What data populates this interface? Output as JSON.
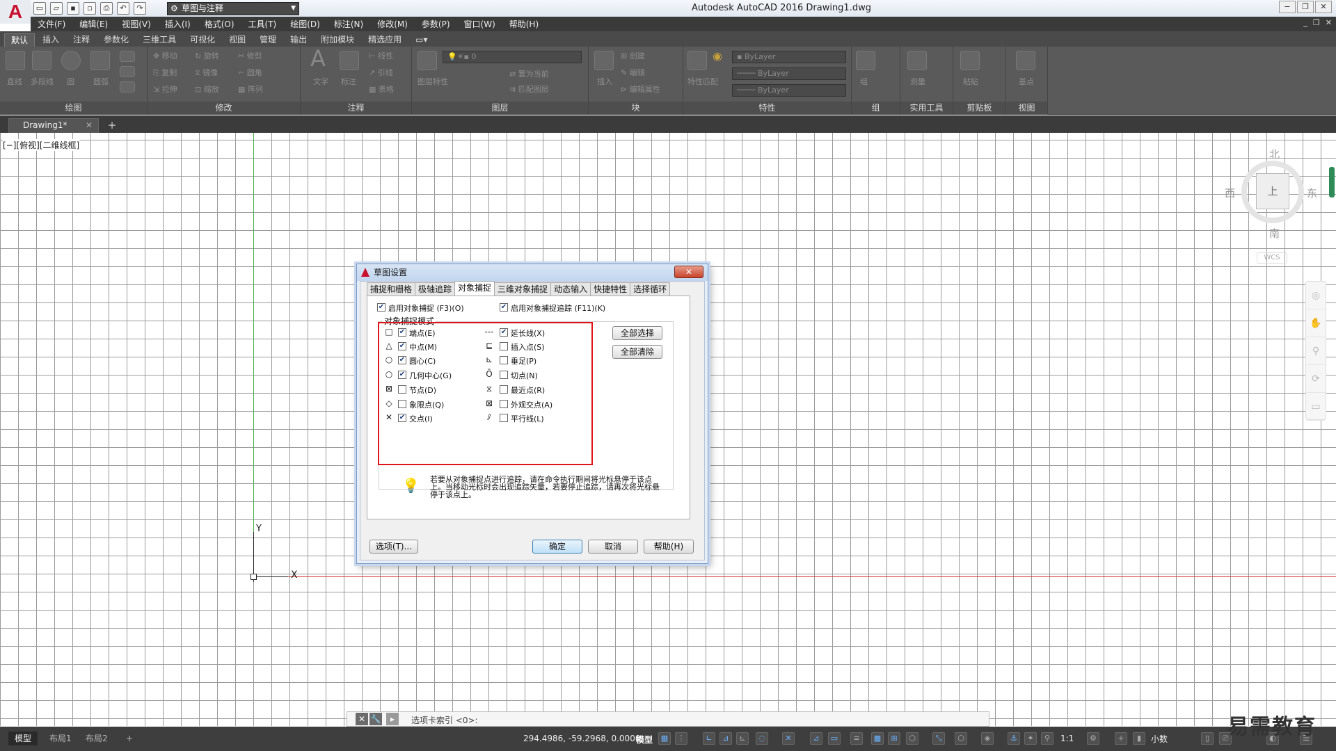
{
  "app": {
    "title": "Autodesk AutoCAD 2016    Drawing1.dwg",
    "workspace": "草图与注释",
    "window_buttons": [
      "−",
      "❐",
      "✕"
    ],
    "menu_window_buttons": [
      "_",
      "❐",
      "✕"
    ]
  },
  "menu": [
    "文件(F)",
    "编辑(E)",
    "视图(V)",
    "插入(I)",
    "格式(O)",
    "工具(T)",
    "绘图(D)",
    "标注(N)",
    "修改(M)",
    "参数(P)",
    "窗口(W)",
    "帮助(H)"
  ],
  "ribbon_tabs": [
    "默认",
    "插入",
    "注释",
    "参数化",
    "三维工具",
    "可视化",
    "视图",
    "管理",
    "输出",
    "附加模块",
    "精选应用"
  ],
  "ribbon": {
    "draw": {
      "title": "绘图",
      "tools": [
        "直线",
        "多段线",
        "圆",
        "圆弧"
      ]
    },
    "modify": {
      "title": "修改",
      "rows": [
        [
          "移动",
          "旋转",
          "修剪"
        ],
        [
          "复制",
          "镜像",
          "圆角"
        ],
        [
          "拉伸",
          "缩放",
          "阵列"
        ]
      ]
    },
    "annotation": {
      "title": "注释",
      "tools": [
        "文字",
        "标注"
      ],
      "small": [
        "线性",
        "引线",
        "表格"
      ]
    },
    "layers": {
      "title": "图层",
      "tools": [
        "图层特性"
      ],
      "layer_value": "0",
      "small": [
        "置为当前",
        "匹配图层"
      ]
    },
    "block": {
      "title": "块",
      "tools": [
        "插入"
      ],
      "small": [
        "创建",
        "编辑",
        "编辑属性"
      ]
    },
    "properties": {
      "title": "特性",
      "tools": [
        "特性匹配"
      ],
      "combos": [
        "ByLayer",
        "ByLayer",
        "ByLayer"
      ]
    },
    "groups": {
      "title": "组",
      "tools": [
        "组"
      ]
    },
    "utilities": {
      "title": "实用工具",
      "tools": [
        "测量"
      ]
    },
    "clipboard": {
      "title": "剪贴板",
      "tools": [
        "粘贴"
      ]
    },
    "view": {
      "title": "视图",
      "tools": [
        "基点"
      ]
    }
  },
  "document_tab": "Drawing1*",
  "viewport_label": "[−][俯视][二维线框]",
  "ucs": {
    "y": "Y",
    "x": "X"
  },
  "viewcube": {
    "north": "北",
    "south": "南",
    "west": "西",
    "east": "东",
    "top": "上",
    "wcs": "WCS"
  },
  "dialog": {
    "title": "草图设置",
    "tabs": [
      "捕捉和栅格",
      "极轴追踪",
      "对象捕捉",
      "三维对象捕捉",
      "动态输入",
      "快捷特性",
      "选择循环"
    ],
    "active_tab": "对象捕捉",
    "enable_osnap": {
      "label": "启用对象捕捉 (F3)(O)",
      "checked": true
    },
    "enable_tracking": {
      "label": "启用对象捕捉追踪 (F11)(K)",
      "checked": true
    },
    "group_title": "对象捕捉模式",
    "left_modes": [
      {
        "symbol": "□",
        "label": "端点(E)",
        "checked": true
      },
      {
        "symbol": "△",
        "label": "中点(M)",
        "checked": true
      },
      {
        "symbol": "○",
        "label": "圆心(C)",
        "checked": true
      },
      {
        "symbol": "○",
        "label": "几何中心(G)",
        "checked": true
      },
      {
        "symbol": "⊠",
        "label": "节点(D)",
        "checked": false
      },
      {
        "symbol": "◇",
        "label": "象限点(Q)",
        "checked": false
      },
      {
        "symbol": "✕",
        "label": "交点(I)",
        "checked": true
      }
    ],
    "right_modes": [
      {
        "symbol": "---",
        "label": "延长线(X)",
        "checked": true
      },
      {
        "symbol": "⊑",
        "label": "插入点(S)",
        "checked": false
      },
      {
        "symbol": "⊾",
        "label": "垂足(P)",
        "checked": false
      },
      {
        "symbol": "Ō",
        "label": "切点(N)",
        "checked": false
      },
      {
        "symbol": "⧖",
        "label": "最近点(R)",
        "checked": false
      },
      {
        "symbol": "⊠",
        "label": "外观交点(A)",
        "checked": false
      },
      {
        "symbol": "⫽",
        "label": "平行线(L)",
        "checked": false
      }
    ],
    "select_all": "全部选择",
    "clear_all": "全部清除",
    "tip": "若要从对象捕捉点进行追踪，请在命令执行期间将光标悬停于该点上。当移动光标时会出现追踪矢量，若要停止追踪，请再次将光标悬停于该点上。",
    "options_btn": "选项(T)...",
    "ok_btn": "确定",
    "cancel_btn": "取消",
    "help_btn": "帮助(H)"
  },
  "command_line": {
    "text": "选项卡索引 <0>:"
  },
  "status": {
    "layout_tabs": [
      "模型",
      "布局1",
      "布局2"
    ],
    "coords": "294.4986, -59.2968, 0.0000",
    "model": "模型",
    "scale": "1:1",
    "units": "小数"
  },
  "watermark": "易需教育"
}
